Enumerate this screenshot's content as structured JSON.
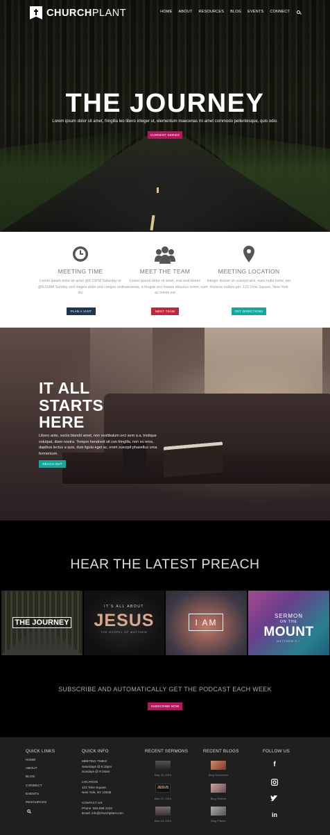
{
  "nav": {
    "logo_bold": "CHURCH",
    "logo_light": "PLANT",
    "items": [
      "HOME",
      "ABOUT",
      "RESOURCES",
      "BLOG",
      "EVENTS",
      "CONNECT"
    ]
  },
  "hero": {
    "title": "THE JOURNEY",
    "subtitle": "Lorem ipsum dolor sit amet, fringilla leo libero integer ut, elementum maecenas mi amet commodo pellentesque, quis odio.",
    "button": "CURRENT SERIES"
  },
  "info": [
    {
      "icon": "clock-icon",
      "heading": "MEETING TIME",
      "text": "Lorem ipsum dolor sit amet @6:15PM Saturday or @9:15AM Sunday sed magna dolor sed congue sed dui",
      "button": "PLAN A VISIT",
      "color": "#1d3551"
    },
    {
      "icon": "team-icon",
      "heading": "MEET THE TEAM",
      "text": "Lorem ipsum dolor sit amet, erat erat donec maecenas, a feugiat orci massa ridiculus lorem, cum ac minim est",
      "button": "MEET TEAM",
      "color": "#c0263d"
    },
    {
      "icon": "map-pin-icon",
      "heading": "MEETING LOCATION",
      "text": "Integer dictum sit suscipit wisi, nunc nulla tortor, per rhoncus nullam per. 123 Time Square, New York",
      "button": "GET DIRECTIONS",
      "color": "#13a89e"
    }
  ],
  "starts": {
    "title_lines": [
      "IT ALL",
      "STARTS",
      "HERE"
    ],
    "text": "Libero ante, sociis blandit amet, non vestibulum orci sem a a, tristique volutpat, diam nostra. Tempor hendrerit sit con fringilla, non eu eros, dapibus lectus a quis, duis ligula eget ac, enim suscipit phasellus urna fermentum.",
    "button": "REACH OUT",
    "button_color": "#13a89e"
  },
  "preach": {
    "title": "HEAR THE LATEST PREACH",
    "sermons": [
      {
        "title": "THE JOURNEY",
        "name": "sermon-the-journey"
      },
      {
        "small": "IT'S ALL ABOUT",
        "title": "JESUS",
        "caption": "THE GOSPEL OF MATTHEW",
        "name": "sermon-jesus"
      },
      {
        "title": "I AM",
        "name": "sermon-i-am"
      },
      {
        "small": "SERMON",
        "mid": "ON THE",
        "title": "MOUNT",
        "caption": "MATTHEW 5-7",
        "name": "sermon-mount"
      }
    ],
    "subscribe_text": "SUBSCRIBE AND AUTOMATICALLY GET THE PODCAST EACH WEEK",
    "subscribe_button": "SUBSCRIBE NOW",
    "accent": "#b5165e"
  },
  "footer": {
    "quick_links": {
      "heading": "QUICK LINKS",
      "items": [
        "HOME",
        "ABOUT",
        "BLOG",
        "CONNECT",
        "EVENTS",
        "RESOURCES"
      ]
    },
    "quick_info": {
      "heading": "QUICK INFO",
      "lines": [
        "MEETING TIMES",
        "Saturdays @ 6:15pm",
        "Sundays @ 9:15am",
        "",
        "LOCATION",
        "123 Time Square",
        "New York, NY 10036",
        "",
        "CONTACT US",
        "Phone: 555.888.1234",
        "Email: info@churchplant.com"
      ]
    },
    "recent_sermons": {
      "heading": "RECENT SERMONS",
      "items": [
        "May 29, 2016",
        "May 22, 2016",
        "May 15, 2016"
      ]
    },
    "recent_blogs": {
      "heading": "RECENT BLOGS",
      "items": [
        "Blog Seventeen",
        "Blog Sixteen",
        "Blog Fifteen"
      ]
    },
    "follow": {
      "heading": "FOLLOW US",
      "icons": [
        "facebook-icon",
        "instagram-icon",
        "twitter-icon",
        "linkedin-icon"
      ]
    }
  }
}
